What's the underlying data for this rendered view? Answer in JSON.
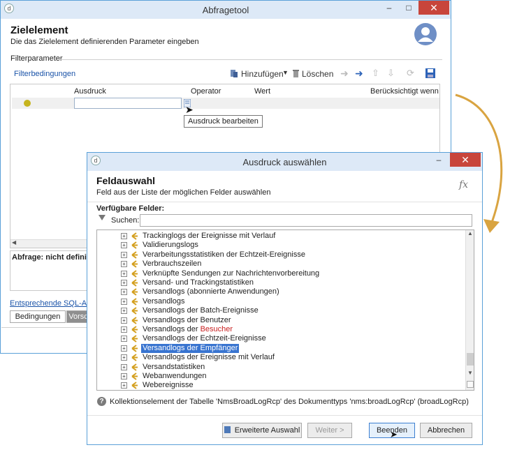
{
  "back_window": {
    "title": "Abfragetool",
    "header_title": "Zielelement",
    "header_subtitle": "Die das Zielelement definierenden Parameter eingeben",
    "filter_section": "Filterparameter",
    "filter_link": "Filterbedingungen",
    "add_label": "Hinzufügen",
    "delete_label": "Löschen",
    "col_expression": "Ausdruck",
    "col_operator": "Operator",
    "col_value": "Wert",
    "col_considered": "Berücksichtigt wenn",
    "tooltip": "Ausdruck bearbeiten",
    "query_status": "Abfrage: nicht definiert",
    "sql_link": "Entsprechende SQL-Abfr",
    "tab_conditions": "Bedingungen",
    "tab_preview": "Vorsc"
  },
  "dialog": {
    "title": "Ausdruck auswählen",
    "header_title": "Feldauswahl",
    "header_subtitle": "Feld aus der Liste der möglichen Felder auswählen",
    "fx_label": "fx",
    "available_fields_label": "Verfügbare Felder:",
    "search_label": "Suchen:",
    "search_value": "",
    "tree_items": [
      {
        "label": "Trackinglogs der Ereignisse mit Verlauf",
        "highlight": ""
      },
      {
        "label": "Validierungslogs",
        "highlight": ""
      },
      {
        "label": "Verarbeitungsstatistiken der Echtzeit-Ereignisse",
        "highlight": ""
      },
      {
        "label": "Verbrauchszeilen",
        "highlight": ""
      },
      {
        "label": "Verknüpfte Sendungen zur Nachrichtenvorbereitung",
        "highlight": ""
      },
      {
        "label": "Versand- und Trackingstatistiken",
        "highlight": ""
      },
      {
        "label": "Versandlogs (abonnierte Anwendungen)",
        "highlight": ""
      },
      {
        "label": "Versandlogs",
        "highlight": ""
      },
      {
        "label": "Versandlogs der Batch-Ereignisse",
        "highlight": ""
      },
      {
        "label": "Versandlogs der Benutzer",
        "highlight": ""
      },
      {
        "label": "Versandlogs der ",
        "highlight": "Besucher"
      },
      {
        "label": "Versandlogs der Echtzeit-Ereignisse",
        "highlight": ""
      },
      {
        "label": "Versandlogs der Empfänger",
        "highlight": "",
        "selected": true
      },
      {
        "label": "Versandlogs der Ereignisse mit Verlauf",
        "highlight": ""
      },
      {
        "label": "Versandstatistiken",
        "highlight": ""
      },
      {
        "label": "Webanwendungen",
        "highlight": ""
      },
      {
        "label": "Webereignisse",
        "highlight": ""
      }
    ],
    "info_text": "Kollektionselement der Tabelle 'NmsBroadLogRcp' des Dokumenttyps 'nms:broadLogRcp' (broadLogRcp)",
    "btn_advanced": "Erweiterte Auswahl",
    "btn_next": "Weiter >",
    "btn_finish": "Beenden",
    "btn_cancel": "Abbrechen"
  },
  "colors": {
    "accent": "#3874d0",
    "link": "#1a53a8",
    "close": "#c8453b",
    "arrow": "#d9a441"
  }
}
